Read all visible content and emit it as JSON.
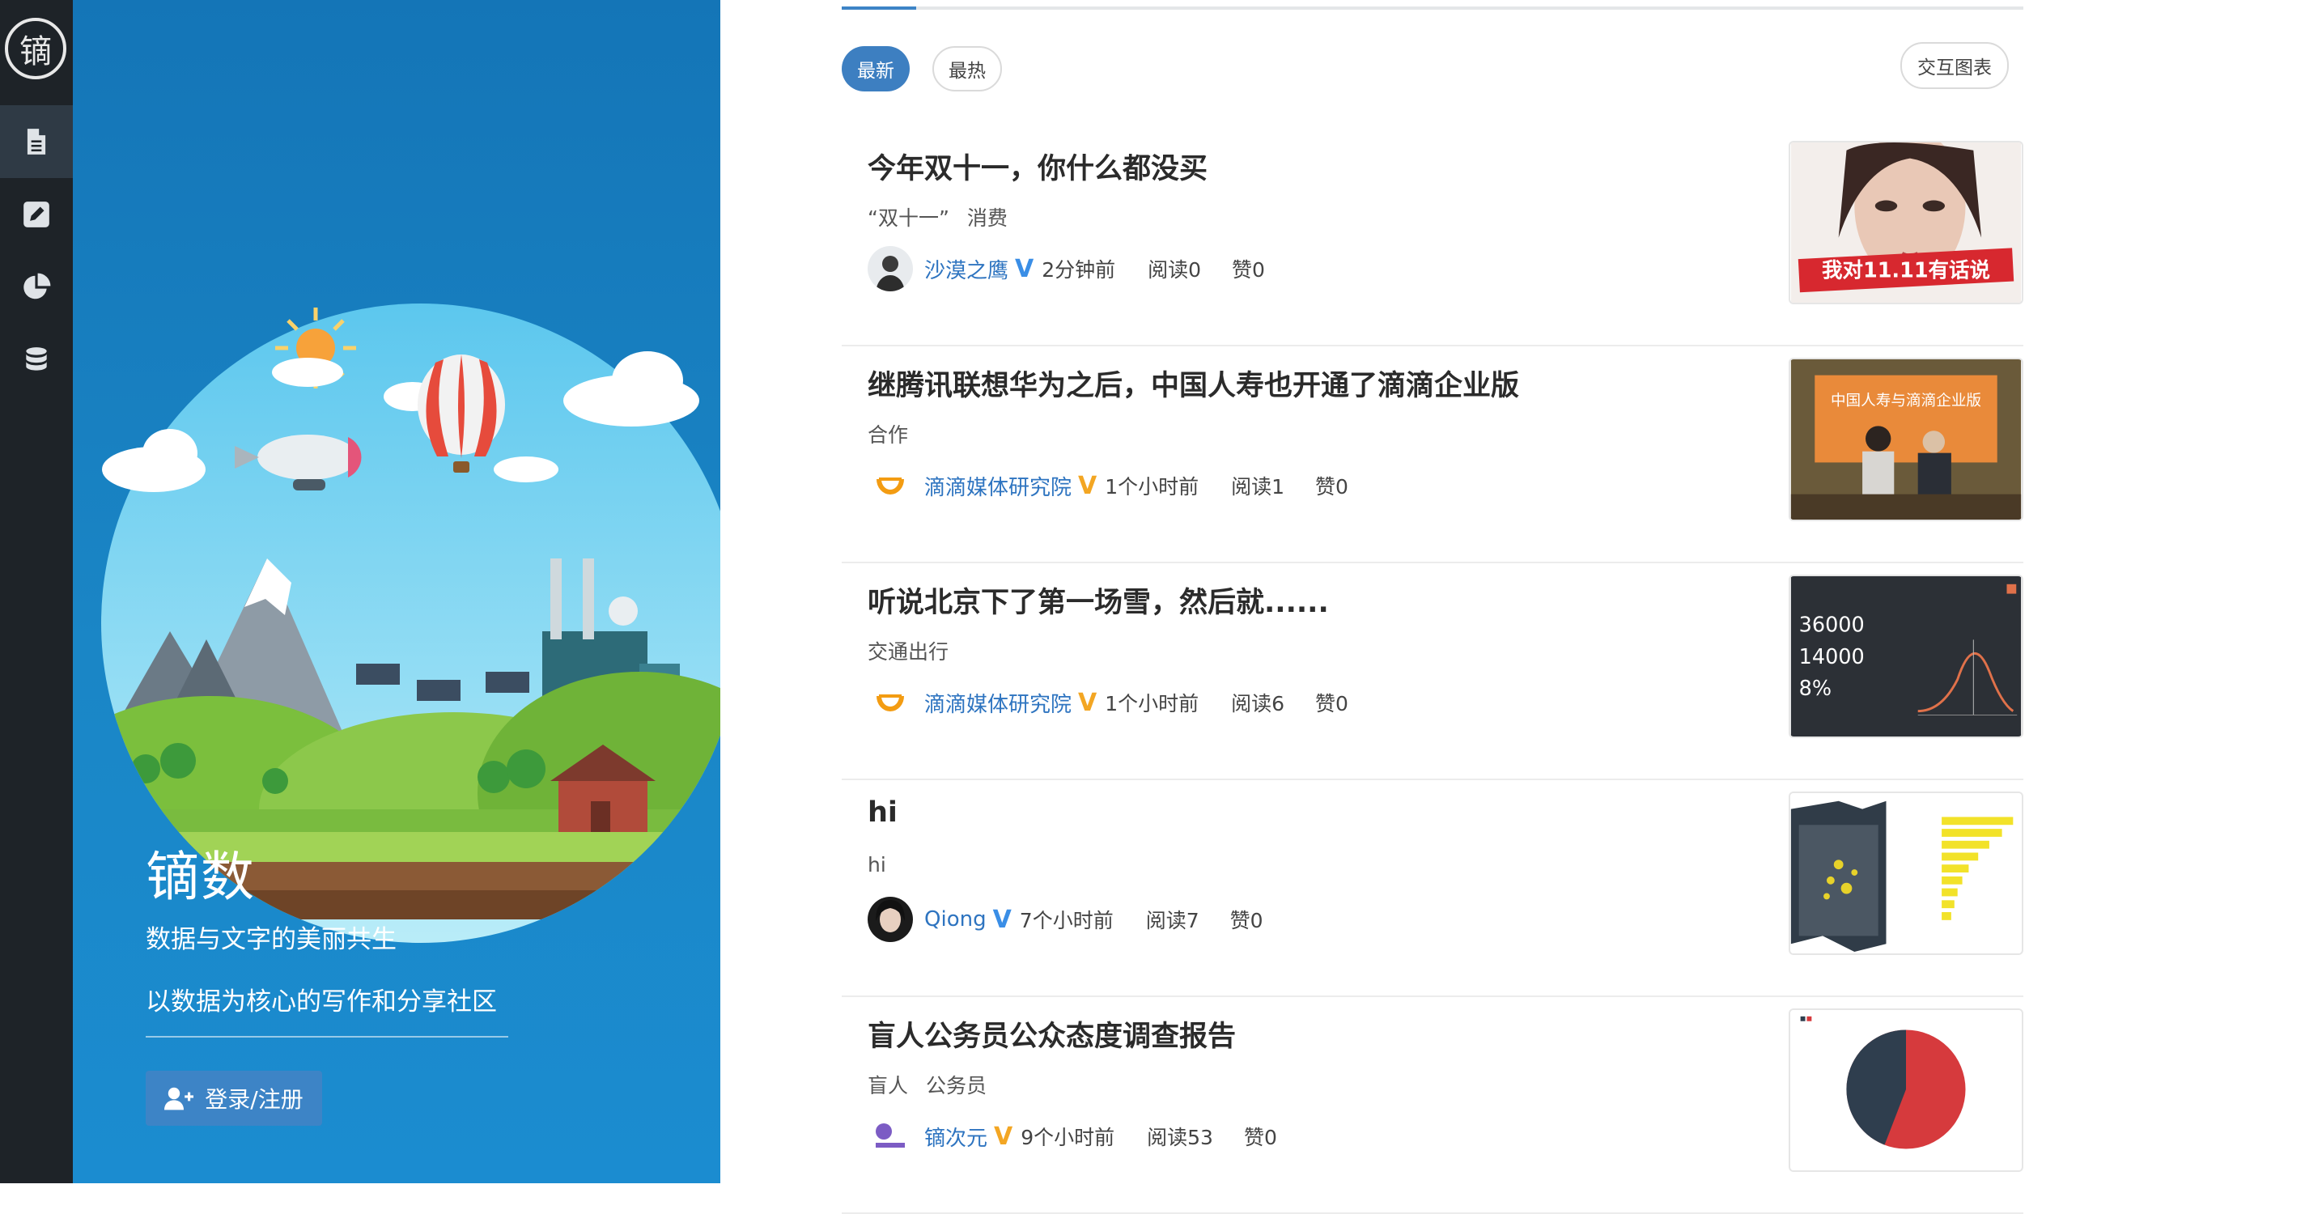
{
  "rail": {
    "logo_char": "镝",
    "items": [
      {
        "name": "articles",
        "icon": "document-icon",
        "active": true
      },
      {
        "name": "write",
        "icon": "pencil-icon",
        "active": false
      },
      {
        "name": "charts",
        "icon": "pie-chart-icon",
        "active": false
      },
      {
        "name": "data",
        "icon": "database-icon",
        "active": false
      }
    ]
  },
  "hero": {
    "title": "镝数",
    "subtitle1": "数据与文字的美丽共生",
    "subtitle2": "以数据为核心的写作和分享社区",
    "login_label": "登录/注册"
  },
  "tabs": {
    "latest": "最新",
    "hot": "最热",
    "interactive_chart": "交互图表"
  },
  "articles": [
    {
      "title": "今年双十一，你什么都没买",
      "tags": [
        "“双十一”",
        "消费"
      ],
      "author": "沙漠之鹰",
      "verified": "V",
      "badge": "blue",
      "time": "2分钟前",
      "reads": "阅读0",
      "likes": "赞0",
      "thumb_text": "我对11.11有话说"
    },
    {
      "title": "继腾讯联想华为之后，中国人寿也开通了滴滴企业版",
      "tags": [
        "合作"
      ],
      "author": "滴滴媒体研究院",
      "verified": "V",
      "badge": "gold",
      "time": "1个小时前",
      "reads": "阅读1",
      "likes": "赞0",
      "thumb_text": "中国人寿与滴滴企业版"
    },
    {
      "title": "听说北京下了第一场雪，然后就......",
      "tags": [
        "交通出行"
      ],
      "author": "滴滴媒体研究院",
      "verified": "V",
      "badge": "gold",
      "time": "1个小时前",
      "reads": "阅读6",
      "likes": "赞0",
      "thumb_values": [
        "36000",
        "14000",
        "8%"
      ]
    },
    {
      "title": "hi",
      "tags": [
        "hi"
      ],
      "author": "Qiong",
      "verified": "V",
      "badge": "blue",
      "time": "7个小时前",
      "reads": "阅读7",
      "likes": "赞0"
    },
    {
      "title": "盲人公务员公众态度调查报告",
      "tags": [
        "盲人",
        "公务员"
      ],
      "author": "镝次元",
      "verified": "V",
      "badge": "gold",
      "time": "9个小时前",
      "reads": "阅读53",
      "likes": "赞0"
    }
  ],
  "colors": {
    "accent": "#3d84c6",
    "rail": "#1e2328",
    "hero": "#1475b7",
    "verified_blue": "#3a8ee6",
    "verified_gold": "#f3a623"
  }
}
